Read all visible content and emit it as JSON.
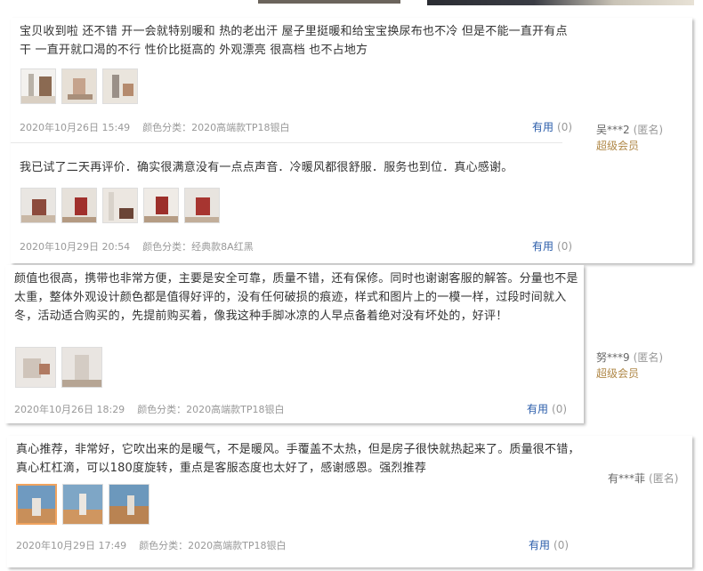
{
  "reviews": [
    {
      "text": "宝贝收到啦 还不错 开一会就特别暖和 热的老出汗 屋子里挺暖和给宝宝换尿布也不冷 但是不能一直开有点干 一直开就口渴的不行 性价比挺高的 外观漂亮 很高档 也不占地方",
      "date": "2020年10月26日 15:49",
      "sku": "颜色分类：2020高端款TP18银白",
      "useful_label": "有用",
      "useful_count": "(0)",
      "images": [
        "product-photo",
        "product-photo",
        "product-photo"
      ]
    },
    {
      "text": "我已试了二天再评价．确实很满意没有一点点声音．冷暖风都很舒服．服务也到位．真心感谢。",
      "date": "2020年10月29日 20:54",
      "sku": "颜色分类：经典款8A红黑",
      "useful_label": "有用",
      "useful_count": "(0)",
      "images": [
        "product-photo",
        "product-photo",
        "product-photo",
        "product-photo",
        "product-photo"
      ]
    },
    {
      "text": "颜值也很高，携带也非常方便，主要是安全可靠，质量不错，还有保修。同时也谢谢客服的解答。分量也不是太重，整体外观设计颜色都是值得好评的，没有任何破损的痕迹，样式和图片上的一模一样，过段时间就入冬，活动适合购买的，先提前购买着，像我这种手脚冰凉的人早点备着绝对没有坏处的，好评！",
      "date": "2020年10月26日 18:29",
      "sku": "颜色分类：2020高端款TP18银白",
      "useful_label": "有用",
      "useful_count": "(0)",
      "images": [
        "product-photo",
        "product-photo"
      ]
    },
    {
      "text": "真心推荐，非常好，它吹出来的是暖气，不是暖风。手覆盖不太热，但是房子很快就热起来了。质量很不错，真心杠杠滴，可以180度旋转，重点是客服态度也太好了，感谢感恩。强烈推荐",
      "date": "2020年10月29日 17:49",
      "sku": "颜色分类：2020高端款TP18银白",
      "useful_label": "有用",
      "useful_count": "(0)",
      "images": [
        "product-photo",
        "product-photo",
        "product-photo"
      ]
    }
  ],
  "users": [
    {
      "name": "吴***2",
      "anon": "(匿名)",
      "level": "超级会员"
    },
    {
      "name": "努***9",
      "anon": "(匿名)",
      "level": "超级会员"
    },
    {
      "name": "有***菲",
      "anon": "(匿名)"
    }
  ]
}
